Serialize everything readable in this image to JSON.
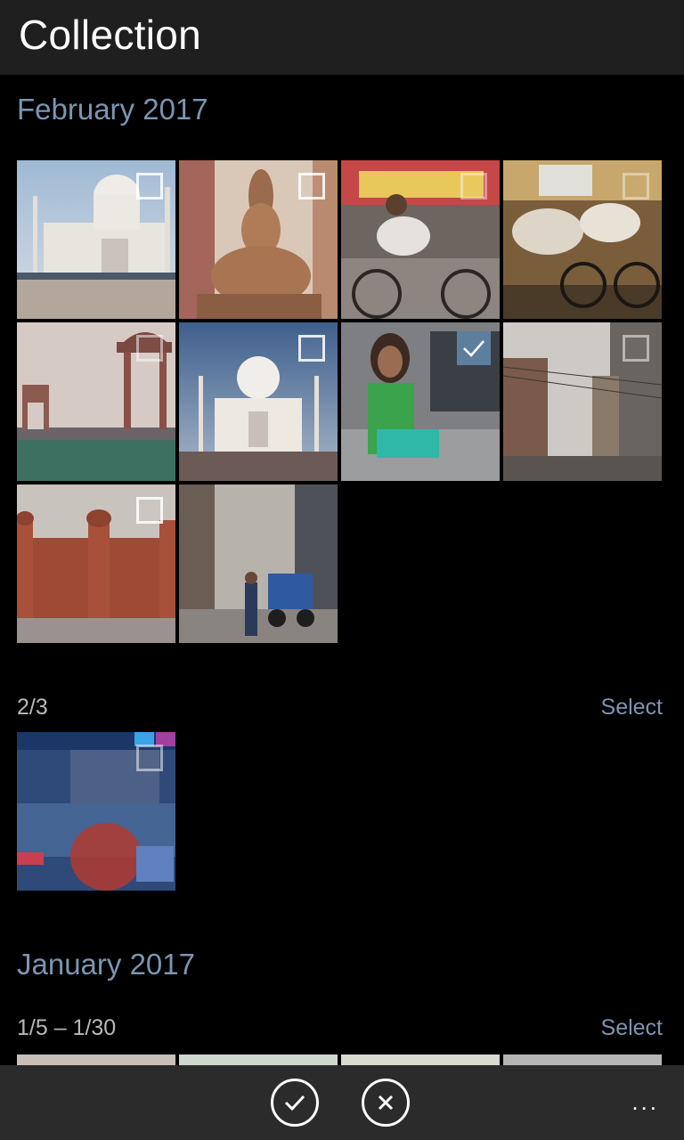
{
  "header": {
    "title": "Collection"
  },
  "sections": {
    "february": {
      "title": "February 2017",
      "photos": [
        {
          "subject": "taj-mahal-daylight",
          "selected": false
        },
        {
          "subject": "stone-statue",
          "selected": false
        },
        {
          "subject": "rickshaw-puller",
          "selected": false
        },
        {
          "subject": "cows-bicycle",
          "selected": false
        },
        {
          "subject": "india-gate",
          "selected": false
        },
        {
          "subject": "taj-mahal-blue-sky",
          "selected": false
        },
        {
          "subject": "girl-with-basket",
          "selected": true
        },
        {
          "subject": "street-buildings",
          "selected": false
        },
        {
          "subject": "red-fort",
          "selected": false
        },
        {
          "subject": "busy-street",
          "selected": false
        }
      ],
      "group2": {
        "label": "2/3",
        "select_label": "Select"
      }
    },
    "january": {
      "title": "January 2017",
      "group1": {
        "label": "1/5 – 1/30",
        "select_label": "Select"
      }
    }
  },
  "appbar": {
    "accept_icon": "checkmark-circle-icon",
    "cancel_icon": "close-circle-icon",
    "more_label": "..."
  },
  "colors": {
    "accent": "#7b95b0",
    "selection": "#5e7e9e",
    "title_bar": "#1f1f1f",
    "app_bar": "#2b2b2b"
  }
}
